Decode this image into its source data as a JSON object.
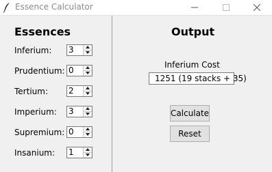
{
  "window": {
    "title": "Essence Calculator",
    "icon": "feather-icon",
    "controls": [
      "minimize-icon",
      "maximize-icon",
      "close-icon"
    ]
  },
  "essences": {
    "heading": "Essences",
    "rows": [
      {
        "label": "Inferium:",
        "value": "3"
      },
      {
        "label": "Prudentium:",
        "value": "0"
      },
      {
        "label": "Tertium:",
        "value": "2"
      },
      {
        "label": "Imperium:",
        "value": "3"
      },
      {
        "label": "Supremium:",
        "value": "0"
      },
      {
        "label": "Insanium:",
        "value": "1"
      }
    ]
  },
  "output": {
    "heading": "Output",
    "cost_label": "Inferium Cost",
    "cost_value": "1251 (19 stacks + 35)",
    "calculate_label": "Calculate",
    "reset_label": "Reset"
  }
}
